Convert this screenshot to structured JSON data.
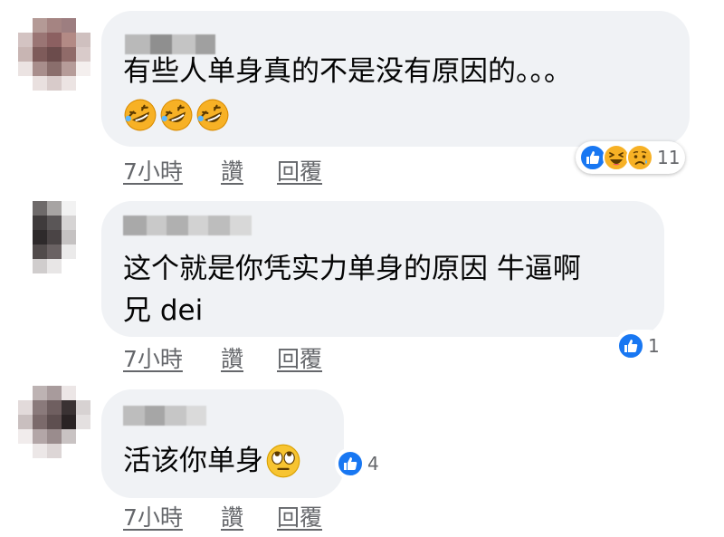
{
  "comments": [
    {
      "text_line1": "有些人单身真的不是没有原因的。。。",
      "emojis": [
        "rolling-on-floor-laughing-emoji",
        "rolling-on-floor-laughing-emoji",
        "rolling-on-floor-laughing-emoji"
      ],
      "reactions": [
        "like-reaction-icon",
        "haha-reaction-icon",
        "sad-reaction-icon"
      ],
      "reaction_count": "11",
      "time": "7小時",
      "like_label": "讚",
      "reply_label": "回覆"
    },
    {
      "text_line1": "这个就是你凭实力单身的原因 牛逼啊",
      "text_line2": "兄 dei",
      "reactions": [
        "like-reaction-icon"
      ],
      "reaction_count": "1",
      "time": "7小時",
      "like_label": "讚",
      "reply_label": "回覆"
    },
    {
      "text_line1": "活该你单身",
      "emojis": [
        "face-with-rolling-eyes-emoji"
      ],
      "reactions": [
        "like-reaction-icon"
      ],
      "reaction_count": "4",
      "time": "7小時",
      "like_label": "讚",
      "reply_label": "回覆"
    }
  ],
  "colors": {
    "bubble": "#f0f2f5",
    "text": "#050505",
    "meta": "#65676b",
    "like_blue": "#1877f2",
    "haha_yellow": "#f7b125"
  }
}
